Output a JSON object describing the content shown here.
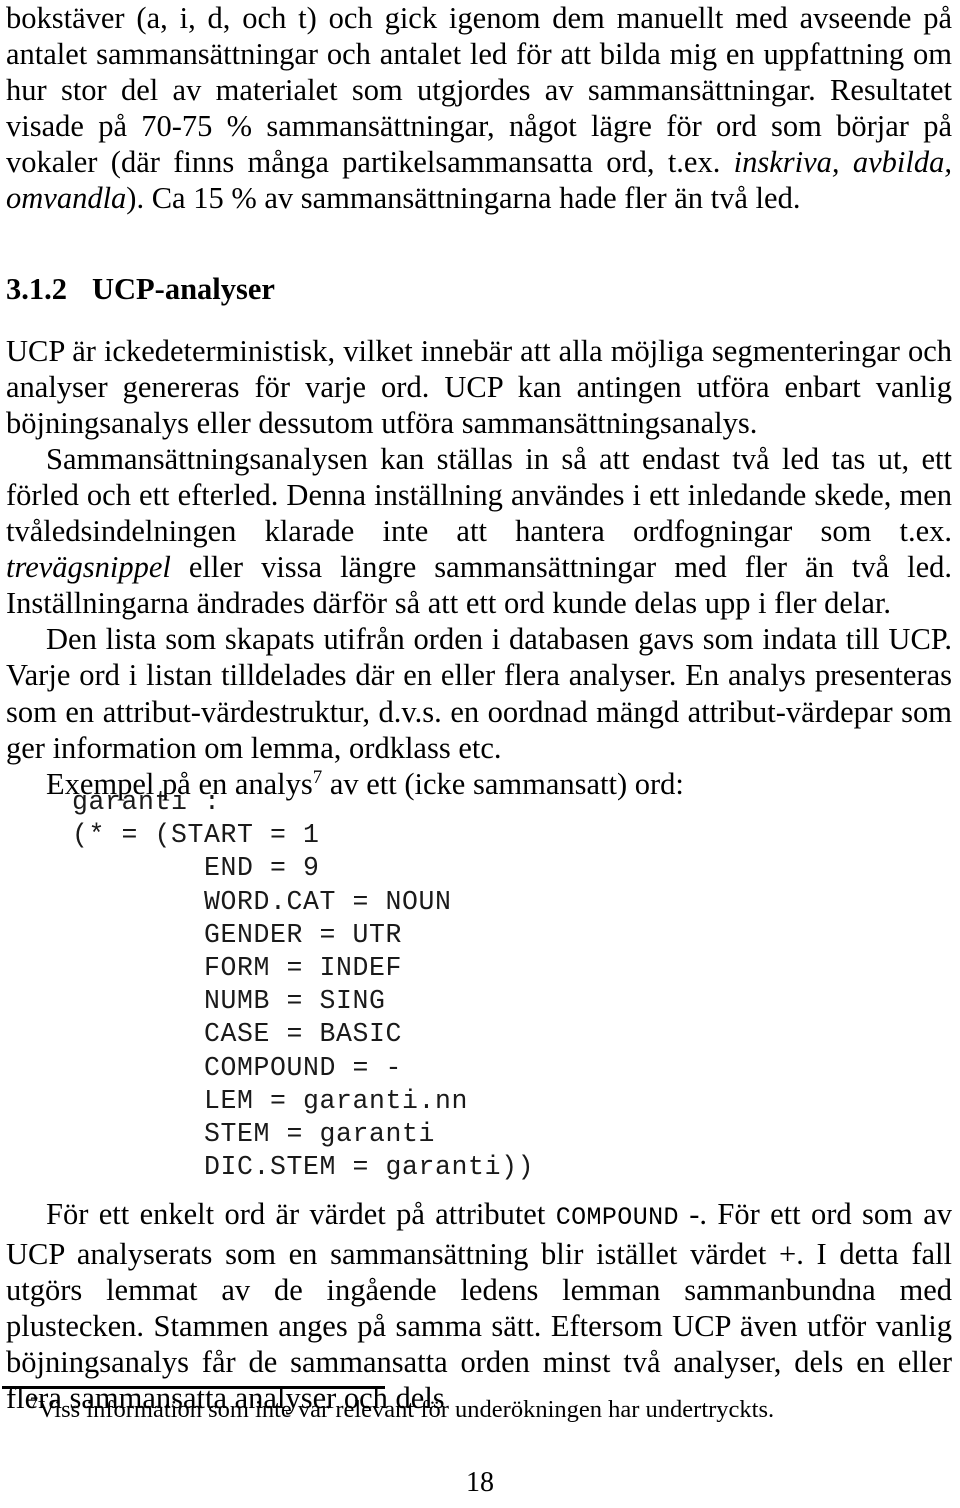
{
  "document": {
    "page_number": "18",
    "language": "sv"
  },
  "paragraphs": {
    "p1_lines": [
      "bokstäver (a, i, d, och t) och gick igenom dem manuellt med avseende på an-",
      "talet sammansättningar och antalet led för att bilda mig en uppfattning om hur",
      "stor del av materialet som utgjordes av sammansättningar. Resultatet visade på",
      "70-75 % sammansättningar, något lägre för ord som börjar på vokaler (där finns",
      "många partikelsammansatta ord, t.ex. inskriva, avbilda, omvandla). Ca 15 % av",
      "sammansättningarna hade fler än två led."
    ],
    "p1_a": "bokstäver (a, i, d, och t) och gick igenom dem manuellt med avseende på antalet sammansättningar och antalet led för att bilda mig en uppfattning om hur stor del av materialet som utgjordes av sammansättningar. Resultatet visade på 70-75 % sammansättningar, något lägre för ord som börjar på vokaler (där finns många partikelsammansatta ord, t.ex. ",
    "p1_italic": "inskriva, avbilda, omvandla",
    "p1_b": "). Ca 15 % av sammansättningarna hade fler än två led.",
    "p2": "UCP är ickedeterministisk, vilket innebär att alla möjliga segmenteringar och analyser genereras för varje ord. UCP kan antingen utföra enbart vanlig böjningsanalys eller dessutom utföra sammansättningsanalys.",
    "p3_a": "Sammansättningsanalysen kan ställas in så att endast två led tas ut, ett förled och ett efterled. Denna inställning användes i ett inledande skede, men tvåledsindelningen klarade inte att hantera ordfogningar som t.ex. ",
    "p3_italic": "trevägsnippel",
    "p3_b": " eller vissa längre sammansättningar med fler än två led. Inställningarna ändrades därför så att ett ord kunde delas upp i fler delar.",
    "p4": "Den lista som skapats utifrån orden i databasen gavs som indata till UCP. Varje ord i listan tilldelades där en eller flera analyser. En analys presenteras som en attribut-värdestruktur, d.v.s. en oordnad mängd attribut-värdepar som ger information om lemma, ordklass etc.",
    "p5_a": "Exempel på en analys",
    "p5_footnote_mark": "7",
    "p5_b": " av ett (icke sammansatt) ord:",
    "p6_a": "För ett enkelt ord är värdet på attributet ",
    "p6_code": "COMPOUND",
    "p6_b": " -. För ett ord som av UCP analyserats som en sammansättning blir istället värdet +. I detta fall utgörs lemmat av de ingående ledens lemman sammanbundna med plustecken. Stammen anges på samma sätt. Eftersom UCP även utför vanlig böjningsanalys får de sammansatta orden minst två analyser, dels en eller flera sammansatta analyser och dels"
  },
  "heading": {
    "number": "3.1.2",
    "title": "UCP-analyser"
  },
  "code_example": {
    "lines": [
      "garanti :",
      "(* = (START = 1",
      "        END = 9",
      "        WORD.CAT = NOUN",
      "        GENDER = UTR",
      "        FORM = INDEF",
      "        NUMB = SING",
      "        CASE = BASIC",
      "        COMPOUND = -",
      "        LEM = garanti.nn",
      "        STEM = garanti",
      "        DIC.STEM = garanti))"
    ],
    "text": "garanti :\n(* = (START = 1\n        END = 9\n        WORD.CAT = NOUN\n        GENDER = UTR\n        FORM = INDEF\n        NUMB = SING\n        CASE = BASIC\n        COMPOUND = -\n        LEM = garanti.nn\n        STEM = garanti\n        DIC.STEM = garanti))"
  },
  "footnote": {
    "mark": "7",
    "text": "Viss information som inte var relevant för underökningen har undertryckts."
  },
  "colors": {
    "page_background": "#ffffff",
    "text": "#000000",
    "code_text": "#1a1a1a",
    "rule": "#000000"
  }
}
